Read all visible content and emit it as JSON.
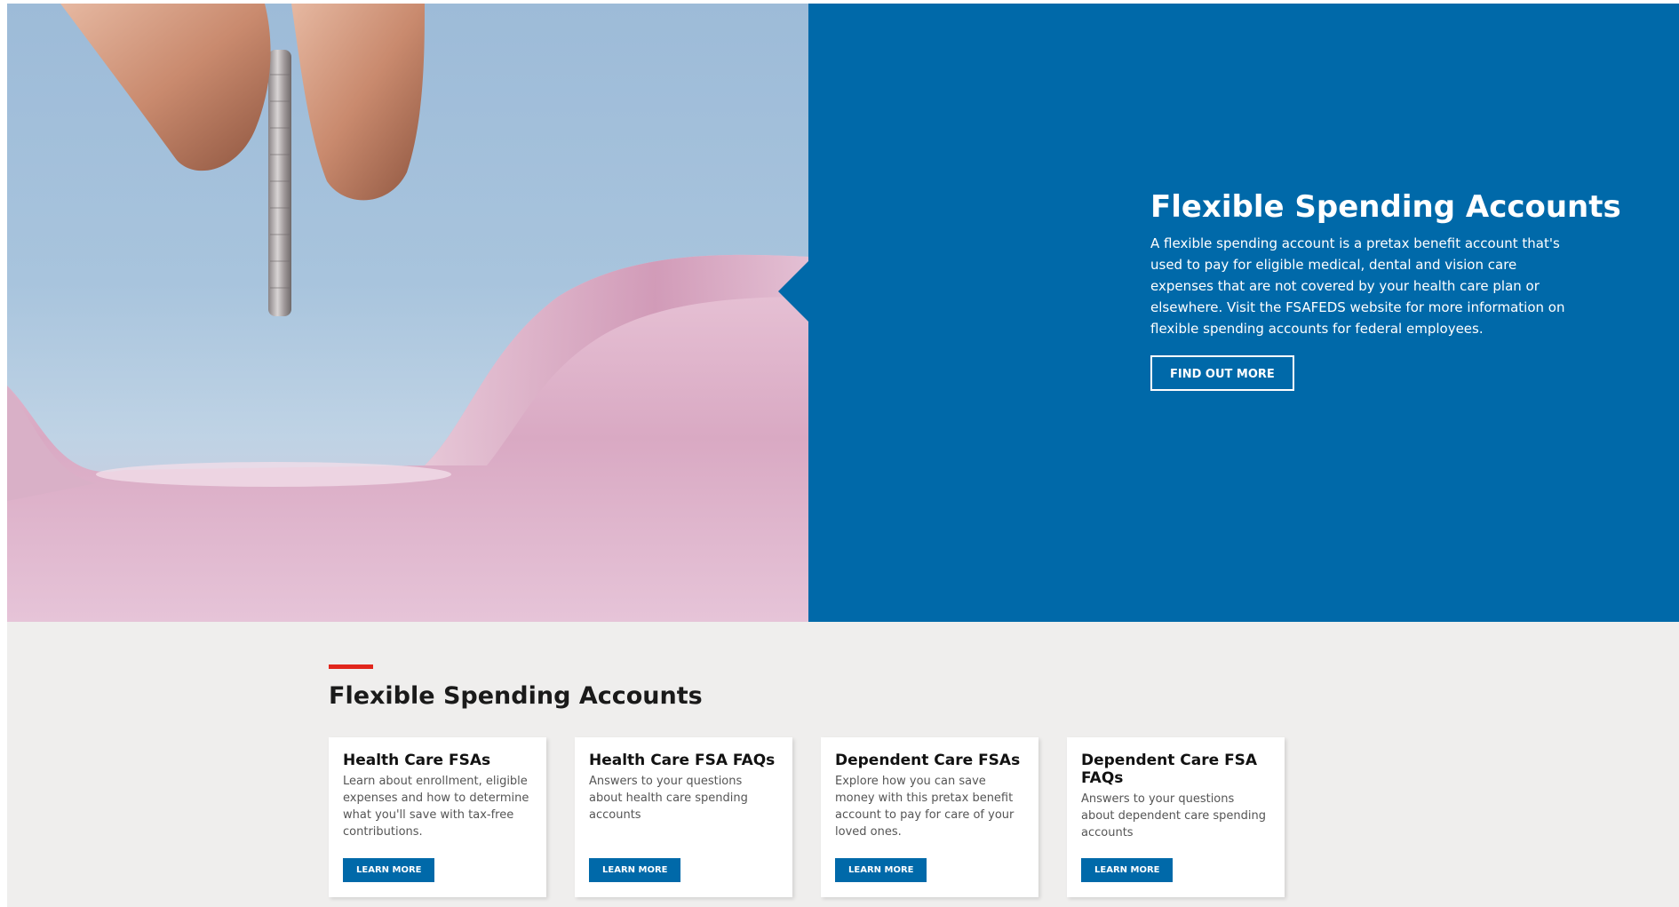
{
  "hero": {
    "title": "Flexible Spending Accounts",
    "description": "A flexible spending account is a pretax benefit account that's used to pay for eligible medical, dental and vision care expenses that are not covered by your health care plan or elsewhere. Visit the FSAFEDS website for more information on flexible spending accounts for federal employees.",
    "button_label": "FIND OUT MORE",
    "panel_color": "#0069a9"
  },
  "section": {
    "title": "Flexible Spending Accounts",
    "accent_color": "#e1261c"
  },
  "cards": [
    {
      "title": "Health Care FSAs",
      "description": "Learn about enrollment, eligible expenses and how to determine what you'll save with tax-free contributions.",
      "button_label": "LEARN MORE"
    },
    {
      "title": "Health Care FSA FAQs",
      "description": "Answers to your questions about health care spending accounts",
      "button_label": "LEARN MORE"
    },
    {
      "title": "Dependent Care FSAs",
      "description": "Explore how you can save money with this pretax benefit account to pay for care of your loved ones.",
      "button_label": "LEARN MORE"
    },
    {
      "title": "Dependent Care FSA FAQs",
      "description": "Answers to your questions about dependent care spending accounts",
      "button_label": "LEARN MORE"
    }
  ]
}
